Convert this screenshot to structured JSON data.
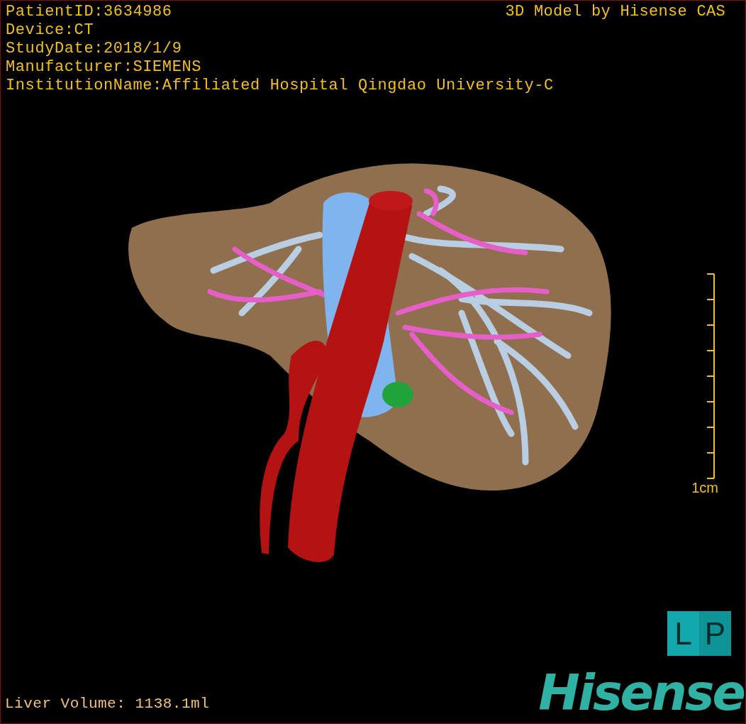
{
  "patient_info": [
    "PatientID:3634986",
    "Device:CT",
    "StudyDate:2018/1/9",
    "Manufacturer:SIEMENS",
    "InstitutionName:Affiliated Hospital Qingdao University-C"
  ],
  "model_credit": "3D Model by Hisense CAS",
  "scale_bar": {
    "label": "1cm"
  },
  "orientation_marker": [
    "L",
    "P"
  ],
  "liver_volume": "Liver Volume: 1138.1ml",
  "logo": "Hisense"
}
